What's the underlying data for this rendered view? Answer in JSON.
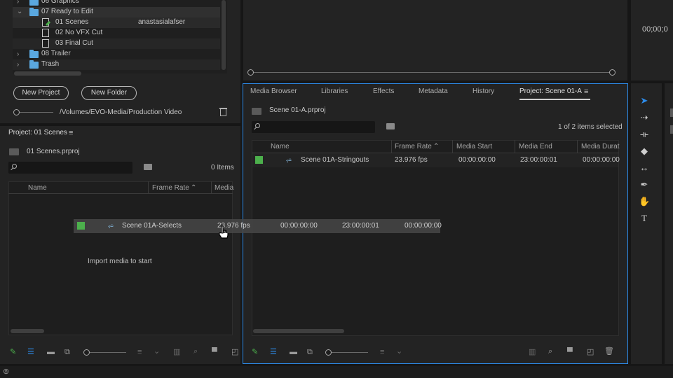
{
  "colors": {
    "accent": "#2d8ceb",
    "label_green": "#4cb04c",
    "folder_blue": "#5aa8e0",
    "panel_bg": "#232323"
  },
  "bin_tree": {
    "items": [
      {
        "label": "06 Graphics",
        "icon": "folder-icon",
        "expanded": false
      },
      {
        "label": "07 Ready to Edit",
        "icon": "folder-icon",
        "expanded": true
      },
      {
        "label": "01 Scenes",
        "icon": "edited-file-icon",
        "owner": "anastasialafser"
      },
      {
        "label": "02 No VFX Cut",
        "icon": "file-icon"
      },
      {
        "label": "03 Final Cut",
        "icon": "file-icon"
      },
      {
        "label": "08 Trailer",
        "icon": "folder-icon",
        "expanded": false
      },
      {
        "label": "Trash",
        "icon": "folder-icon",
        "expanded": false
      }
    ]
  },
  "production": {
    "new_project_label": "New Project",
    "new_folder_label": "New Folder",
    "path": "/Volumes/EVO-Media/Production Video"
  },
  "program_timecode": "00;00;0",
  "left_panel": {
    "title": "Project: 01 Scenes",
    "file": "01 Scenes.prproj",
    "items_count": "0 Items",
    "columns": [
      "Name",
      "Frame Rate",
      "Media"
    ],
    "empty_message": "Import media to start"
  },
  "drag_item": {
    "name": "Scene 01A-Selects",
    "frame_rate": "23.976 fps",
    "media_start": "00:00:00:00",
    "media_end": "23:00:00:01",
    "media_duration": "00:00:00:00"
  },
  "right_panel": {
    "tabs": [
      "Media Browser",
      "Libraries",
      "Effects",
      "Metadata",
      "History",
      "Project: Scene 01-A"
    ],
    "active_tab": "Project: Scene 01-A",
    "file": "Scene 01-A.prproj",
    "selection_status": "1 of 2 items selected",
    "columns": [
      "Name",
      "Frame Rate",
      "Media Start",
      "Media End",
      "Media Durat"
    ],
    "rows": [
      {
        "name": "Scene 01A-Stringouts",
        "frame_rate": "23.976 fps",
        "media_start": "00:00:00:00",
        "media_end": "23:00:00:01",
        "media_duration": "00:00:00:00"
      }
    ]
  },
  "tools": [
    "selection-tool-icon",
    "track-select-icon",
    "ripple-edit-icon",
    "razor-icon",
    "slip-icon",
    "pen-icon",
    "hand-icon",
    "type-icon"
  ]
}
